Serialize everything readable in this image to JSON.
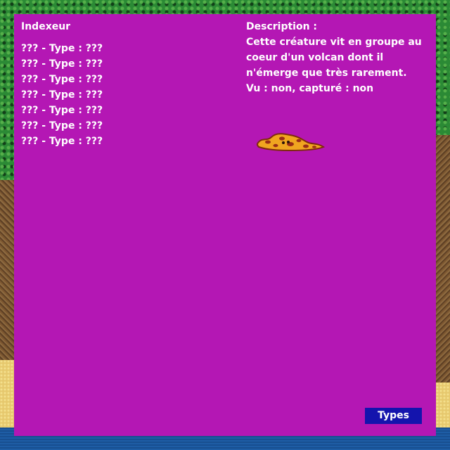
{
  "index": {
    "title": "Indexeur",
    "entries": [
      "??? - Type : ???",
      "??? - Type : ???",
      "??? - Type : ???",
      "??? - Type : ???",
      "??? - Type : ???",
      "??? - Type : ???",
      "??? - Type : ???"
    ]
  },
  "description": {
    "title": "Description :",
    "lines": [
      "Cette créature vit en groupe au",
      "coeur d'un volcan dont il",
      "n'émerge que très rarement.",
      "Vu : non, capturé : non"
    ]
  },
  "buttons": {
    "types_label": "Types"
  },
  "colors": {
    "panel_background": "#b417b4",
    "panel_text": "#ffffff",
    "button_background": "#1414ad",
    "creature_body": "#f0a520",
    "creature_spots": "#9a2d16"
  },
  "icons": {
    "creature": "lava-slug-icon"
  }
}
